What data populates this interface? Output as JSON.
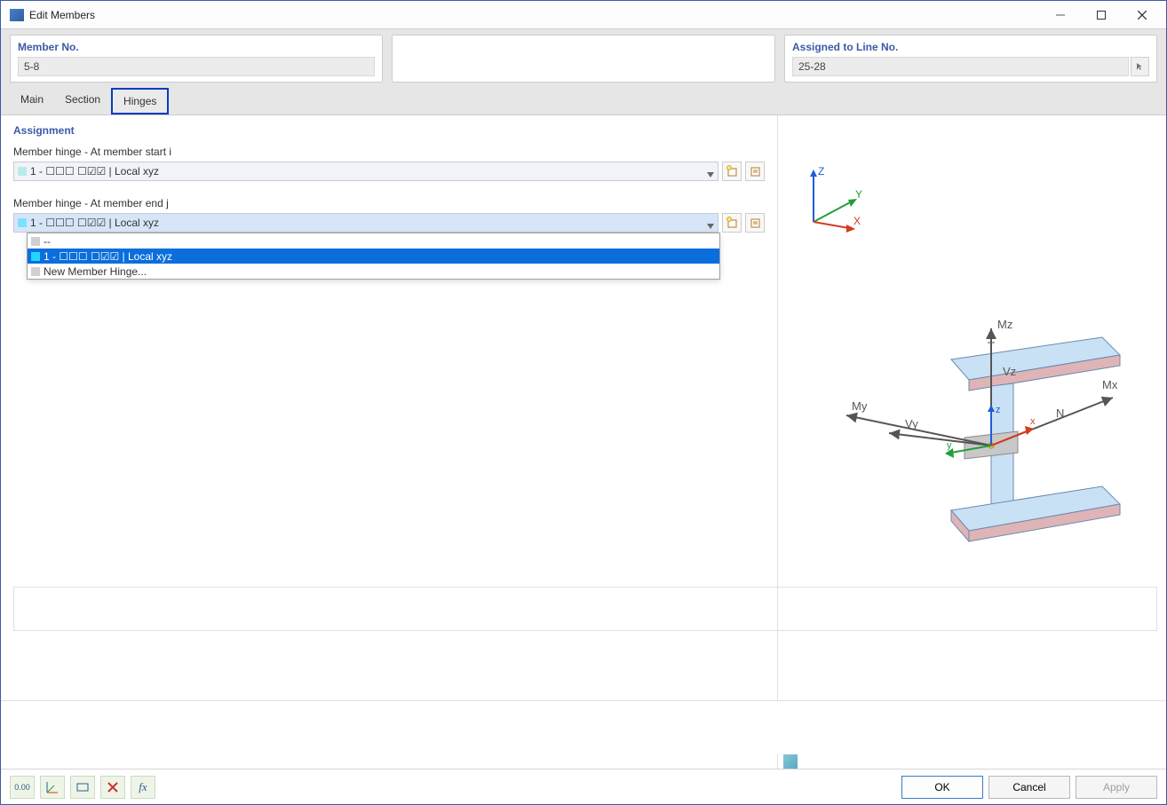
{
  "window": {
    "title": "Edit Members"
  },
  "header": {
    "member_no_label": "Member No.",
    "member_no_value": "5-8",
    "assigned_label": "Assigned to Line No.",
    "assigned_value": "25-28"
  },
  "tabs": {
    "main": "Main",
    "section": "Section",
    "hinges": "Hinges"
  },
  "assignment": {
    "title": "Assignment",
    "start_label": "Member hinge - At member start i",
    "start_value": "1 - ☐☐☐ ☐☑☑ | Local xyz",
    "end_label": "Member hinge - At member end j",
    "end_value": "1 - ☐☐☐ ☐☑☑ | Local xyz",
    "dropdown_options": {
      "blank": "--",
      "opt1": "1 - ☐☐☐ ☐☑☑ | Local xyz",
      "new": "New Member Hinge..."
    }
  },
  "buttons": {
    "ok": "OK",
    "cancel": "Cancel",
    "apply": "Apply"
  },
  "tooltips": {
    "units": "0.00",
    "fx": "fx"
  },
  "axes": {
    "x": "X",
    "y": "Y",
    "z": "Z"
  },
  "diagram_labels": {
    "mz": "Mz",
    "mx": "Mx",
    "my": "My",
    "vz": "Vz",
    "vy": "Vy",
    "n": "N",
    "lx": "x",
    "ly": "y",
    "lz": "z"
  }
}
